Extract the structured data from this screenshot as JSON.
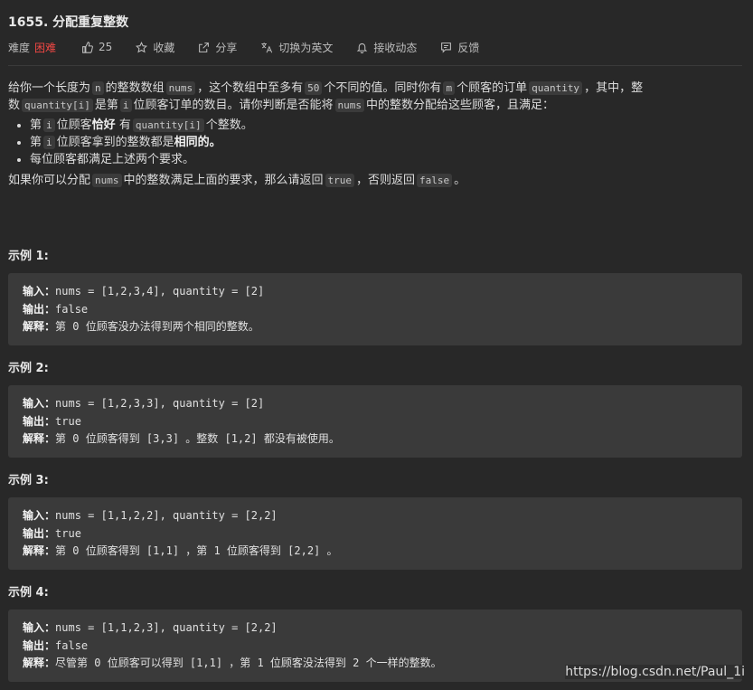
{
  "problem": {
    "title": "1655. 分配重复整数"
  },
  "meta": {
    "difficulty_label": "难度",
    "difficulty": "困难",
    "likes": "25",
    "favorite": "收藏",
    "share": "分享",
    "switch_language": "切换为英文",
    "notifications": "接收动态",
    "feedback": "反馈",
    "colors": {
      "hard": "#ef4743"
    }
  },
  "description": {
    "p1": [
      "给你一个长度为",
      "n",
      "的整数数组",
      "nums",
      "，这个数组中至多有",
      "50",
      "个不同的值。同时你有",
      "m",
      "个顾客的订单",
      "quantity",
      "，其中，整"
    ],
    "p1b": [
      "数",
      "quantity[i]",
      "是第",
      "i",
      "位顾客订单的数目。请你判断是否能将",
      "nums",
      "中的整数分配给这些顾客，且满足："
    ],
    "bullets": [
      [
        "第",
        "i",
        "位顾客",
        "恰好",
        "有",
        "quantity[i]",
        "个整数。"
      ],
      [
        "第",
        "i",
        "位顾客拿到的整数都是",
        "相同的",
        "。"
      ],
      [
        "每位顾客都满足上述两个要求。"
      ]
    ],
    "p2": [
      "如果你可以分配",
      "nums",
      "中的整数满足上面的要求，那么请返回",
      "true",
      "，否则返回",
      "false",
      "。"
    ]
  },
  "examples": [
    {
      "heading": "示例 1:",
      "input_label": "输入：",
      "input": "nums = [1,2,3,4], quantity = [2]",
      "output_label": "输出：",
      "output": "false",
      "explain_label": "解释：",
      "explain": "第 0 位顾客没办法得到两个相同的整数。"
    },
    {
      "heading": "示例 2:",
      "input_label": "输入：",
      "input": "nums = [1,2,3,3], quantity = [2]",
      "output_label": "输出：",
      "output": "true",
      "explain_label": "解释：",
      "explain": "第 0 位顾客得到 [3,3] 。整数 [1,2] 都没有被使用。"
    },
    {
      "heading": "示例 3:",
      "input_label": "输入：",
      "input": "nums = [1,1,2,2], quantity = [2,2]",
      "output_label": "输出：",
      "output": "true",
      "explain_label": "解释：",
      "explain": "第 0 位顾客得到 [1,1] ，第 1 位顾客得到 [2,2] 。"
    },
    {
      "heading": "示例 4:",
      "input_label": "输入：",
      "input": "nums = [1,1,2,3], quantity = [2,2]",
      "output_label": "输出：",
      "output": "false",
      "explain_label": "解释：",
      "explain": "尽管第 0 位顾客可以得到 [1,1] ，第 1 位顾客没法得到 2 个一样的整数。"
    }
  ],
  "watermark": "https://blog.csdn.net/Paul_1i"
}
